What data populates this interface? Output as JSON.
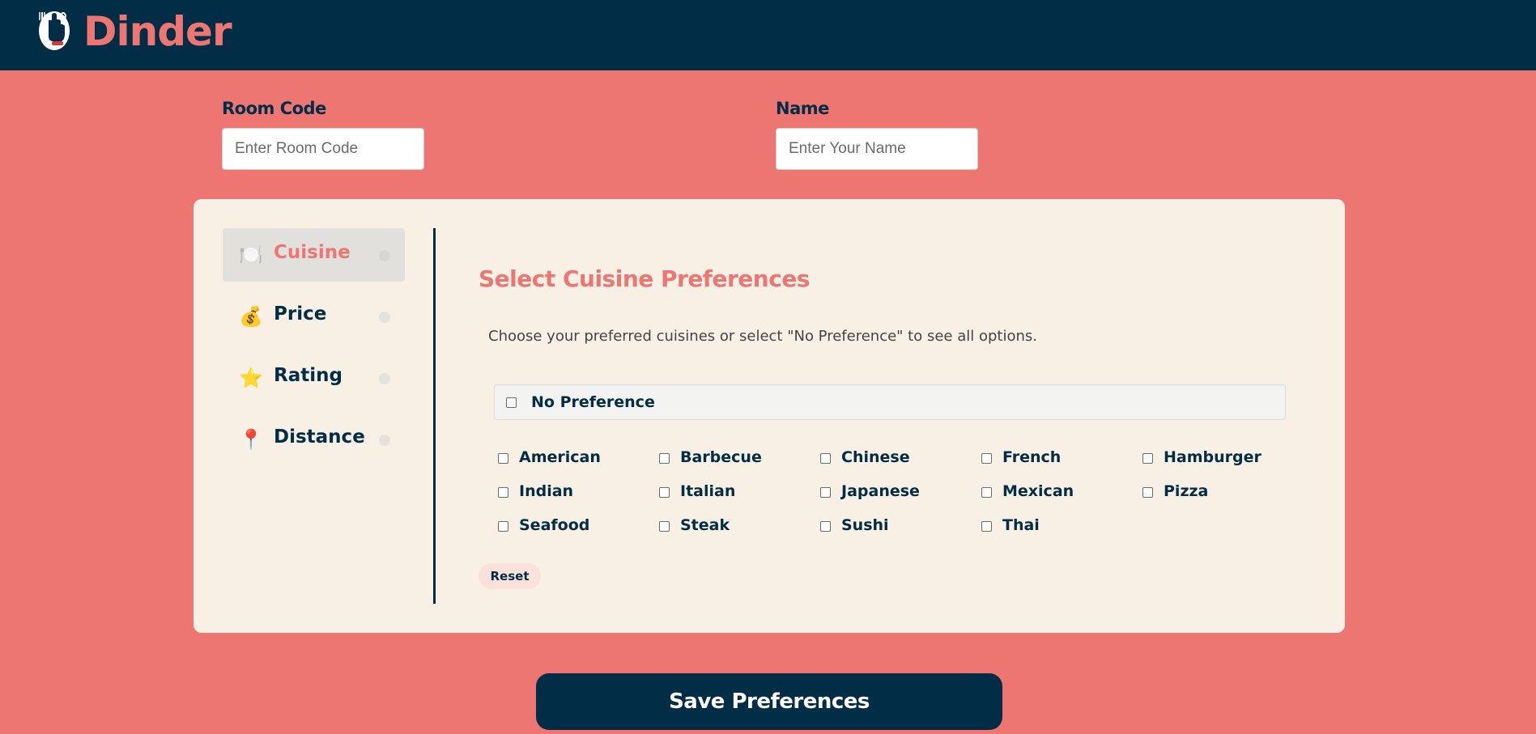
{
  "app": {
    "name": "Dinder",
    "logo_icon": "hand-fork-knife-logo"
  },
  "form": {
    "room_code": {
      "label": "Room Code",
      "placeholder": "Enter Room Code",
      "value": ""
    },
    "name": {
      "label": "Name",
      "placeholder": "Enter Your Name",
      "value": ""
    }
  },
  "sidebar": {
    "items": [
      {
        "label": "Cuisine",
        "icon": "plate-icon",
        "glyph": "🍽️",
        "active": true
      },
      {
        "label": "Price",
        "icon": "money-bag-icon",
        "glyph": "💰",
        "active": false
      },
      {
        "label": "Rating",
        "icon": "star-icon",
        "glyph": "⭐",
        "active": false
      },
      {
        "label": "Distance",
        "icon": "pin-icon",
        "glyph": "📍",
        "active": false
      }
    ]
  },
  "section": {
    "title": "Select Cuisine Preferences",
    "description": "Choose your preferred cuisines or select \"No Preference\" to see all options.",
    "no_preference_label": "No Preference",
    "cuisines": [
      "American",
      "Barbecue",
      "Chinese",
      "French",
      "Hamburger",
      "Indian",
      "Italian",
      "Japanese",
      "Mexican",
      "Pizza",
      "Seafood",
      "Steak",
      "Sushi",
      "Thai"
    ],
    "reset_label": "Reset"
  },
  "save_label": "Save Preferences",
  "colors": {
    "navy": "#022d46",
    "coral": "#ee7672",
    "cream": "#f8f0e4"
  }
}
